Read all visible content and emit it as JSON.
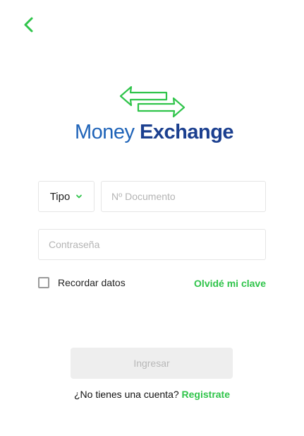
{
  "header": {
    "back_icon": "chevron-left-icon"
  },
  "logo": {
    "icon": "exchange-arrows-icon",
    "word_regular": "Money",
    "word_bold": "Exchange",
    "color_money": "#1e63b8",
    "color_exchange": "#1b3f8f",
    "color_arrows": "#2fc44a"
  },
  "form": {
    "doc_type": {
      "selected": "Tipo",
      "icon": "chevron-down-icon"
    },
    "document": {
      "placeholder": "Nº Documento",
      "value": ""
    },
    "password": {
      "placeholder": "Contraseña",
      "value": ""
    },
    "remember": {
      "label": "Recordar datos",
      "checked": false
    },
    "forgot_link": "Olvidé mi clave",
    "submit_label": "Ingresar",
    "submit_enabled": false
  },
  "footer": {
    "prompt": "¿No tienes una cuenta?",
    "signup_link": "Registrate"
  },
  "colors": {
    "accent": "#2fc44a",
    "border": "#e5e5e5",
    "disabled_button": "#eeeeee"
  }
}
